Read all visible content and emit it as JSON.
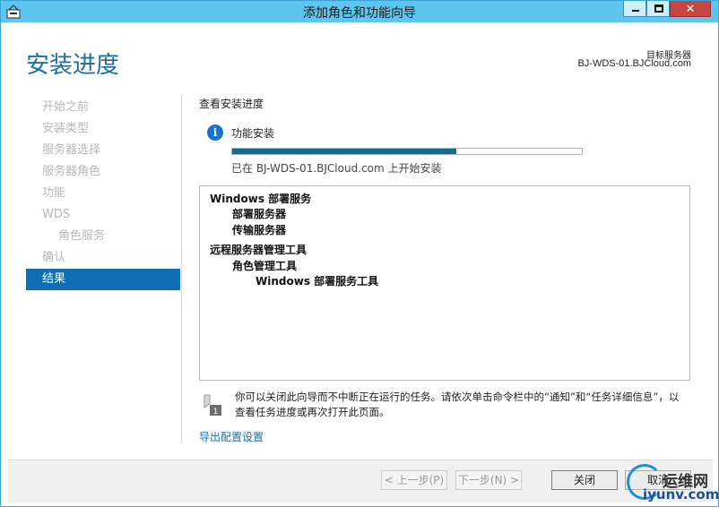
{
  "window": {
    "title": "添加角色和功能向导",
    "close_glyph": "✕"
  },
  "header": {
    "page_title": "安装进度",
    "target_label": "目标服务器",
    "target_server": "BJ-WDS-01.BJCloud.com"
  },
  "sidebar": {
    "items": [
      {
        "label": "开始之前"
      },
      {
        "label": "安装类型"
      },
      {
        "label": "服务器选择"
      },
      {
        "label": "服务器角色"
      },
      {
        "label": "功能"
      },
      {
        "label": "WDS"
      },
      {
        "label": "角色服务"
      },
      {
        "label": "确认"
      },
      {
        "label": "结果"
      }
    ]
  },
  "main": {
    "section_title": "查看安装进度",
    "info_glyph": "i",
    "progress_label": "功能安装",
    "progress_fraction": 0.64,
    "progress_status": "已在 BJ-WDS-01.BJCloud.com 上开始安装",
    "results": [
      "Windows 部署服务",
      "部署服务器",
      "传输服务器",
      "远程服务器管理工具",
      "角色管理工具",
      "Windows 部署服务工具"
    ],
    "note_line1": "你可以关闭此向导而不中断正在运行的任务。请依次单击命令栏中的“通知”和“任务详细信息”，以",
    "note_line2": "查看任务进度或再次打开此页面。",
    "export_link": "导出配置设置"
  },
  "footer": {
    "prev_label": "< 上一步(P)",
    "next_label": "下一步(N) >",
    "close_label": "关闭",
    "cancel_label": "取消"
  },
  "watermark": {
    "top": "运维网",
    "bottom": "iyunv.com"
  },
  "colors": {
    "titlebar": "#5ec6ee",
    "accent": "#0e6fb4",
    "progress": "#126b8f"
  }
}
